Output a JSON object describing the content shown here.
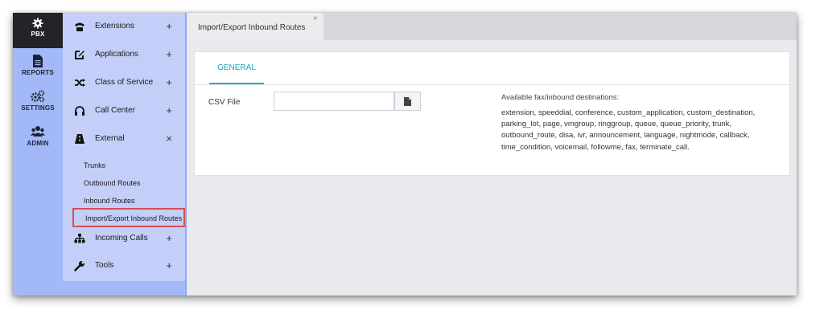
{
  "iconbar": {
    "items": [
      {
        "label": "PBX",
        "icon": "gear-icon",
        "active": true
      },
      {
        "label": "REPORTS",
        "icon": "document-icon",
        "active": false
      },
      {
        "label": "SETTINGS",
        "icon": "cogs-icon",
        "active": false
      },
      {
        "label": "ADMIN",
        "icon": "users-icon",
        "active": false
      }
    ]
  },
  "menu": {
    "items": [
      {
        "label": "Extensions",
        "icon": "phone-icon",
        "sign": "+"
      },
      {
        "label": "Applications",
        "icon": "edit-icon",
        "sign": "+"
      },
      {
        "label": "Class of Service",
        "icon": "shuffle-icon",
        "sign": "+"
      },
      {
        "label": "Call Center",
        "icon": "headset-icon",
        "sign": "+"
      },
      {
        "label": "External",
        "icon": "road-icon",
        "sign": "×"
      },
      {
        "label": "Incoming Calls",
        "icon": "sitemap-icon",
        "sign": "+"
      },
      {
        "label": "Tools",
        "icon": "wrench-icon",
        "sign": "+"
      }
    ],
    "external_subitems": [
      {
        "label": "Trunks"
      },
      {
        "label": "Outbound Routes"
      },
      {
        "label": "Inbound Routes"
      },
      {
        "label": "Import/Export Inbound Routes",
        "selected": true
      }
    ]
  },
  "tabs": {
    "active": {
      "label": "Import/Export Inbound Routes",
      "close": "×"
    }
  },
  "card": {
    "tab_label": "GENERAL",
    "csv_label": "CSV File",
    "csv_value": "",
    "destinations_title": "Available fax/inbound destinations:",
    "destinations_text": "extension, speeddial, conference, custom_application, custom_destination, parking_lot, page, vmgroup, ringgroup, queue, queue_priority, trunk, outbound_route, disa, ivr, announcement, language, nightmode, callback, time_condition, voicemail, followme, fax, terminate_call."
  },
  "colors": {
    "iconbar_bg": "#a3b9f7",
    "menu_bg": "#c3cff9",
    "active_dark": "#232427",
    "accent_teal": "#1aa6b0",
    "selection_border": "#d55050"
  }
}
